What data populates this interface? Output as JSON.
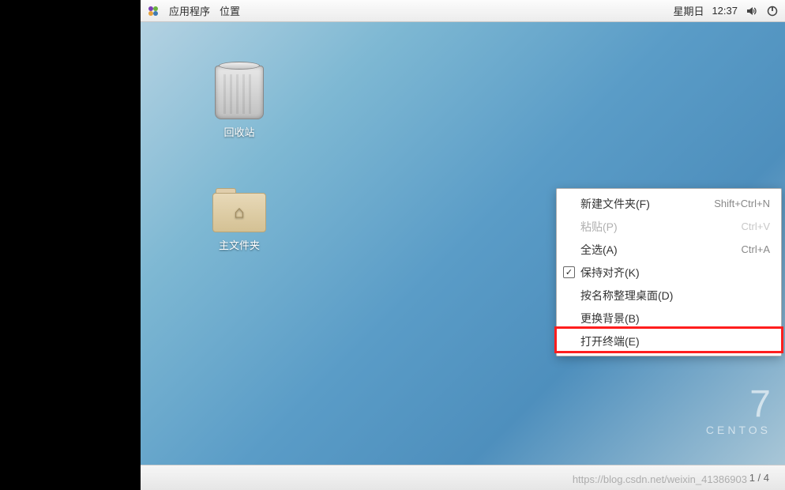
{
  "topbar": {
    "apps_label": "应用程序",
    "places_label": "位置",
    "date": "星期日",
    "time": "12:37"
  },
  "desktop_icons": {
    "trash_label": "回收站",
    "home_label": "主文件夹"
  },
  "context_menu": {
    "items": [
      {
        "label": "新建文件夹(F)",
        "shortcut": "Shift+Ctrl+N",
        "disabled": false,
        "checked": false
      },
      {
        "label": "粘贴(P)",
        "shortcut": "Ctrl+V",
        "disabled": true,
        "checked": false
      },
      {
        "label": "全选(A)",
        "shortcut": "Ctrl+A",
        "disabled": false,
        "checked": false
      },
      {
        "label": "保持对齐(K)",
        "shortcut": "",
        "disabled": false,
        "checked": true
      },
      {
        "label": "按名称整理桌面(D)",
        "shortcut": "",
        "disabled": false,
        "checked": false
      },
      {
        "label": "更换背景(B)",
        "shortcut": "",
        "disabled": false,
        "checked": false
      },
      {
        "label": "打开终端(E)",
        "shortcut": "",
        "disabled": false,
        "checked": false
      }
    ]
  },
  "branding": {
    "version": "7",
    "name": "CENTOS"
  },
  "statusbar": {
    "page": "1 / 4"
  },
  "watermark": "https://blog.csdn.net/weixin_41386903"
}
